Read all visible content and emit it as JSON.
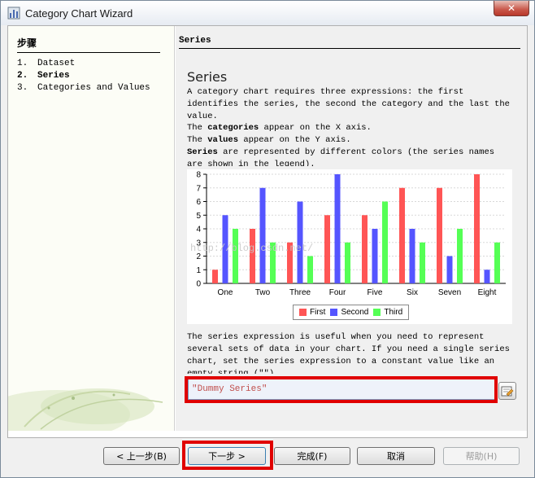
{
  "window": {
    "title": "Category Chart Wizard",
    "close_glyph": "✕"
  },
  "left": {
    "heading": "步骤",
    "steps": [
      {
        "num": "1.",
        "label": "Dataset",
        "active": false
      },
      {
        "num": "2.",
        "label": "Series",
        "active": true
      },
      {
        "num": "3.",
        "label": "Categories and Values",
        "active": false
      }
    ]
  },
  "main": {
    "section_header": "Series",
    "section_title": "Series",
    "intro": "A category chart requires three expressions: the first identifies the series, the second the category and the last the value.",
    "line_categories_pre": "The ",
    "line_categories_bold": "categories",
    "line_categories_post": " appear on the X axis.",
    "line_values_pre": "The ",
    "line_values_bold": "values",
    "line_values_post": " appear on the Y axis.",
    "line_series_bold": "Series",
    "line_series_post": " are represented by different colors (the series names are shown in the legend).",
    "watermark": "http://blog.csdn.net/",
    "series_expression_help": "The series expression is useful when you need to represent several sets of data in your chart. If you need a single series chart, set the series expression to a constant value like an empty string (\"\")",
    "series_expression_value": "\"Dummy Series\"",
    "expr_button_icon": "expression-editor-icon"
  },
  "chart_data": {
    "type": "bar",
    "categories": [
      "One",
      "Two",
      "Three",
      "Four",
      "Five",
      "Six",
      "Seven",
      "Eight"
    ],
    "series": [
      {
        "name": "First",
        "color": "#ff5555",
        "values": [
          1,
          4,
          3,
          5,
          5,
          7,
          7,
          8
        ]
      },
      {
        "name": "Second",
        "color": "#5555ff",
        "values": [
          5,
          7,
          6,
          8,
          4,
          4,
          2,
          1
        ]
      },
      {
        "name": "Third",
        "color": "#55ff55",
        "values": [
          4,
          3,
          2,
          3,
          6,
          3,
          4,
          3
        ]
      }
    ],
    "ylim": [
      0,
      8
    ],
    "yticks": [
      0,
      1,
      2,
      3,
      4,
      5,
      6,
      7,
      8
    ],
    "grid": true,
    "legend": "bottom"
  },
  "buttons": {
    "back": "< 上一步(B)",
    "next": "下一步 >",
    "finish": "完成(F)",
    "cancel": "取消",
    "help": "帮助(H)"
  }
}
